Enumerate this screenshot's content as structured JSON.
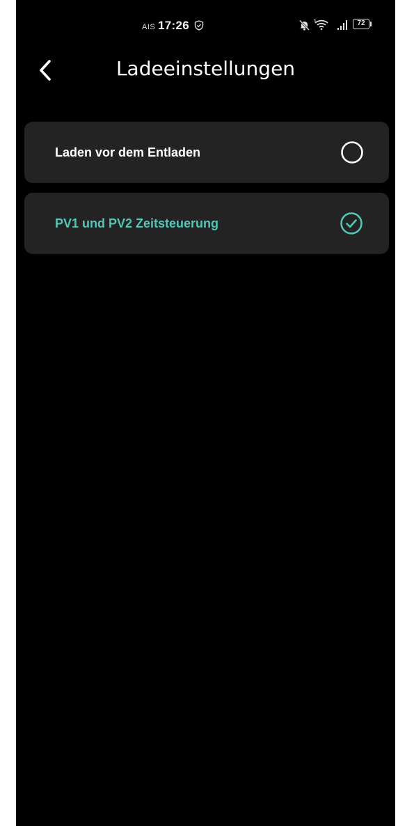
{
  "status_bar": {
    "carrier": "AIS",
    "time": "17:26",
    "battery_level": "72",
    "icons": [
      "vpn-shield-icon",
      "mute-bell-icon",
      "wifi-icon",
      "signal-icon",
      "battery-icon"
    ]
  },
  "header": {
    "title": "Ladeeinstellungen",
    "back_icon": "chevron-left-icon"
  },
  "options": [
    {
      "label": "Laden vor dem Entladen",
      "selected": false,
      "icon": "radio-unchecked-icon"
    },
    {
      "label": "PV1 und PV2 Zeitsteuerung",
      "selected": true,
      "icon": "check-circle-icon"
    }
  ],
  "colors": {
    "background": "#000000",
    "card": "#232323",
    "accent": "#52c7b8",
    "text": "#ffffff"
  }
}
